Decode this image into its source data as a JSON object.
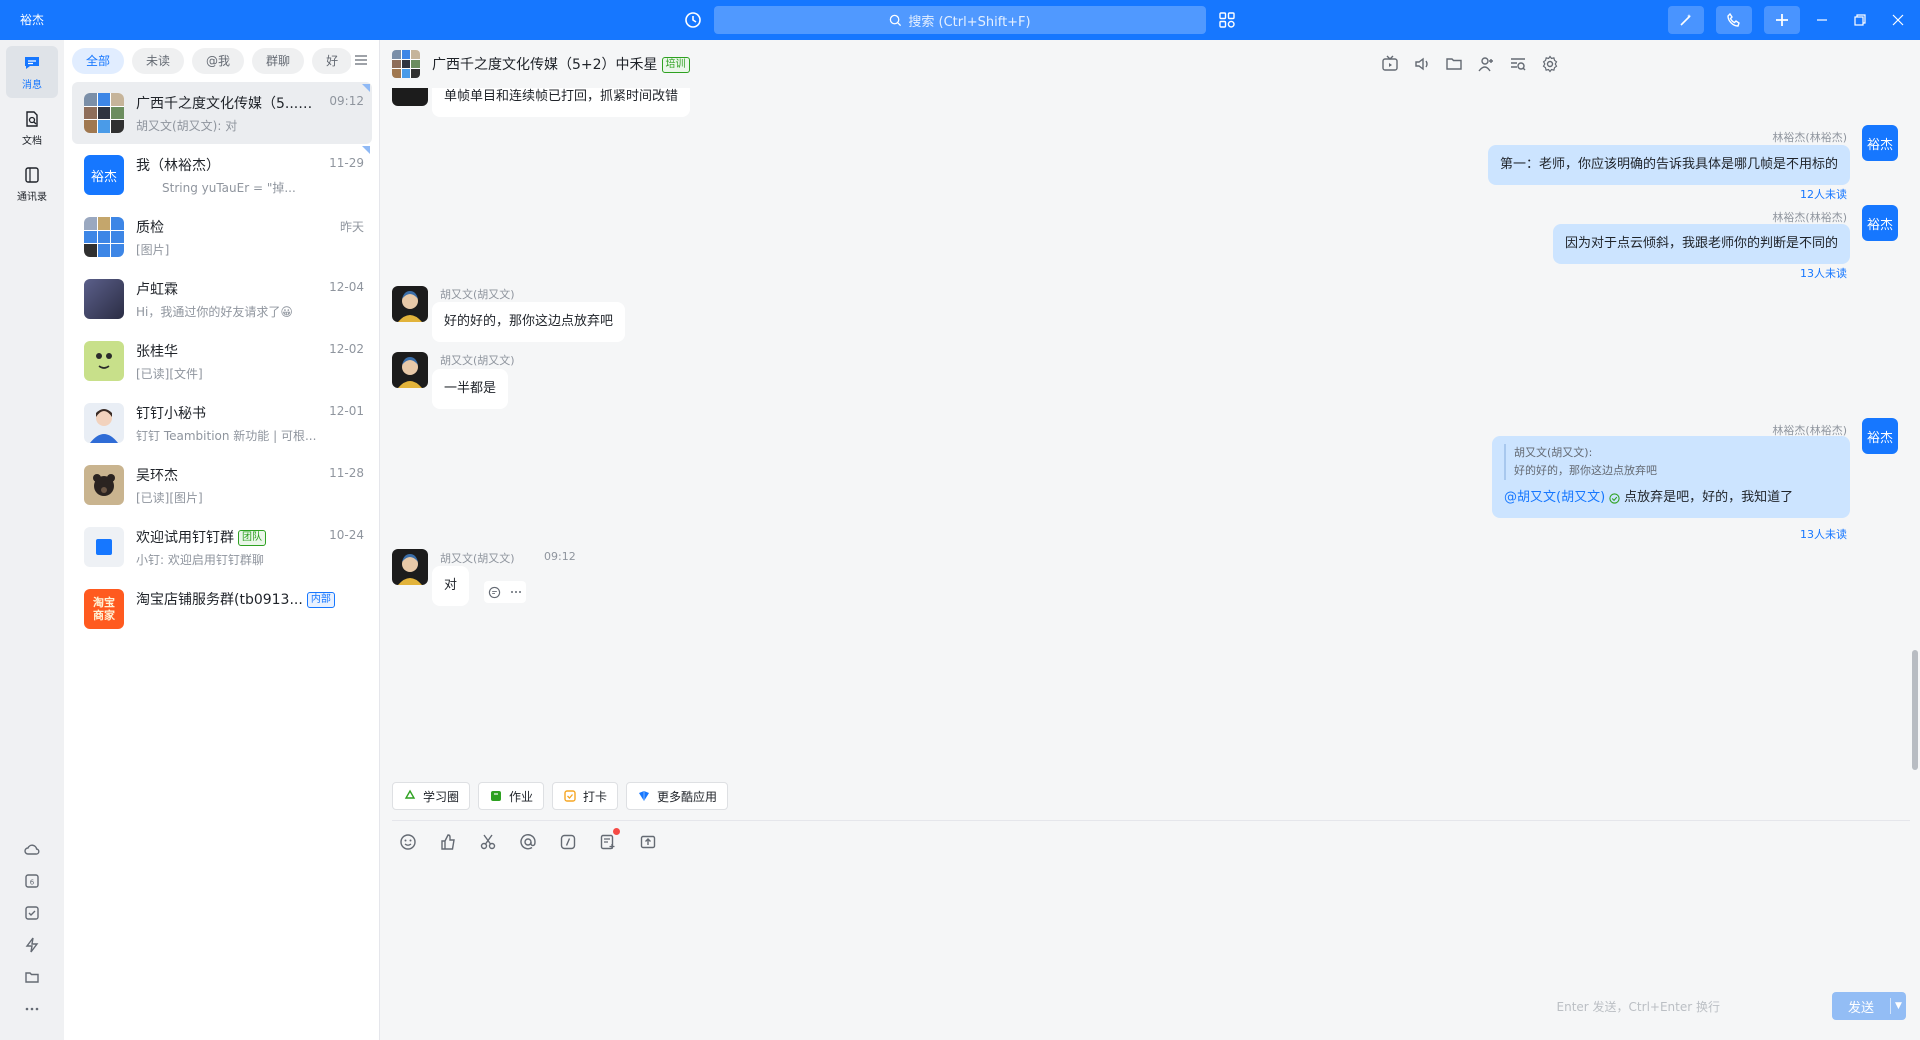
{
  "titlebar": {
    "avatar_text": "裕杰",
    "search_placeholder": "搜索 (Ctrl+Shift+F)"
  },
  "nav": {
    "items": [
      {
        "label": "消息"
      },
      {
        "label": "文档"
      },
      {
        "label": "通讯录"
      }
    ]
  },
  "conversation_list": {
    "filters": [
      "全部",
      "未读",
      "@我",
      "群聊",
      "好"
    ],
    "items": [
      {
        "name": "广西千之度文化传媒（5...",
        "tag": "培训",
        "time": "09:12",
        "preview": "胡又文(胡又文): 对"
      },
      {
        "name": "我（林裕杰）",
        "avatar_text": "裕杰",
        "time": "11-29",
        "preview": "String yuTauEr = \"掉..."
      },
      {
        "name": "质检",
        "time": "昨天",
        "preview": "[图片]"
      },
      {
        "name": "卢虹霖",
        "time": "12-04",
        "preview": "Hi，我通过你的好友请求了😀"
      },
      {
        "name": "张桂华",
        "time": "12-02",
        "preview": "[已读][文件]"
      },
      {
        "name": "钉钉小秘书",
        "time": "12-01",
        "preview": "钉钉 Teambition 新功能 | 可根..."
      },
      {
        "name": "吴环杰",
        "time": "11-28",
        "preview": "[已读][图片]"
      },
      {
        "name": "欢迎试用钉钉群",
        "tag": "团队",
        "time": "10-24",
        "preview": "小钉: 欢迎启用钉钉群聊"
      },
      {
        "name": "淘宝店铺服务群(tb0913...",
        "tag": "内部",
        "avatar_text": "淘宝商家"
      }
    ]
  },
  "chat": {
    "title": "广西千之度文化传媒（5+2）中禾星",
    "title_tag": "培训",
    "messages": [
      {
        "text": "单帧单目和连续帧已打回，抓紧时间改错"
      },
      {
        "sender": "林裕杰(林裕杰)",
        "text": "第一：老师，你应该明确的告诉我具体是哪几帧是不用标的",
        "unread": "12人未读",
        "avatar_text": "裕杰"
      },
      {
        "sender": "林裕杰(林裕杰)",
        "text": "因为对于点云倾斜，我跟老师你的判断是不同的",
        "unread": "13人未读",
        "avatar_text": "裕杰"
      },
      {
        "sender": "胡又文(胡又文)",
        "text": "好的好的，那你这边点放弃吧"
      },
      {
        "sender": "胡又文(胡又文)",
        "text": "一半都是"
      },
      {
        "sender": "林裕杰(林裕杰)",
        "quote_author": "胡又文(胡又文):",
        "quote_text": "好的好的，那你这边点放弃吧",
        "mention": "@胡又文(胡又文)",
        "text": "点放弃是吧，好的，我知道了",
        "unread": "13人未读",
        "avatar_text": "裕杰"
      },
      {
        "sender": "胡又文(胡又文)",
        "time": "09:12",
        "text": "对"
      }
    ],
    "apps": [
      "学习圈",
      "作业",
      "打卡",
      "更多酷应用"
    ],
    "send_hint": "Enter 发送，Ctrl+Enter 换行",
    "send_label": "发送"
  },
  "colors": {
    "accent": "#1677ff",
    "bubble_out": "#cce4ff",
    "tag_green": "#2ea121"
  }
}
